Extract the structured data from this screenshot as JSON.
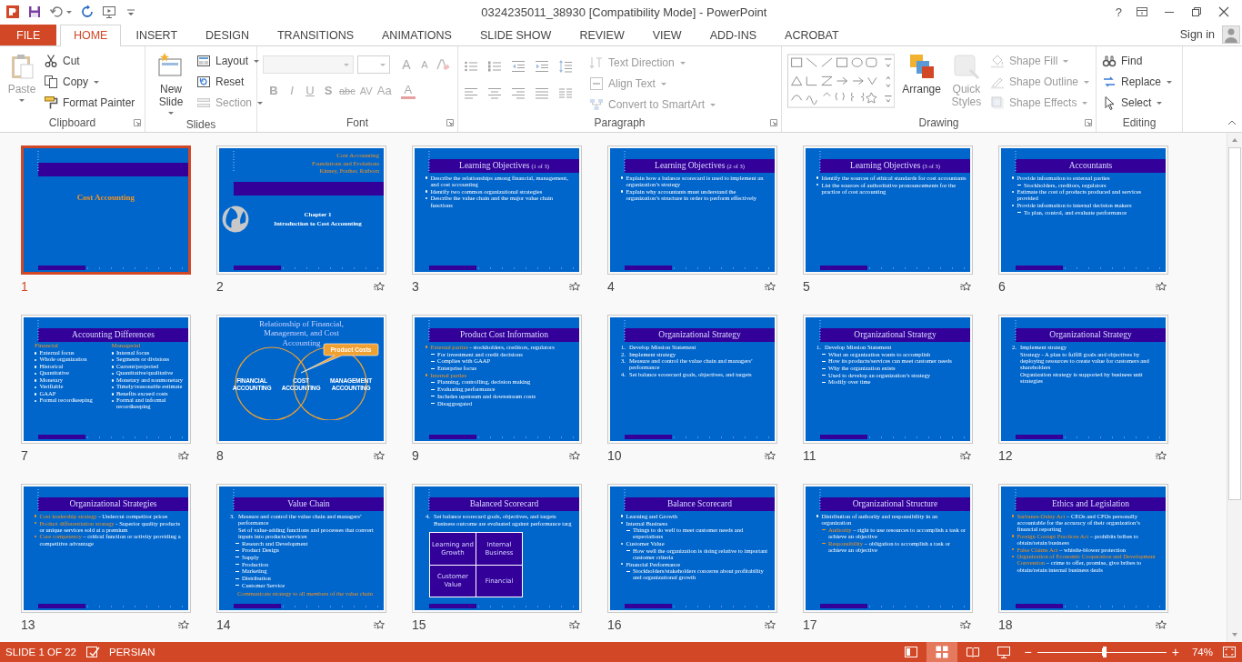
{
  "window": {
    "title": "0324235011_38930 [Compatibility Mode] - PowerPoint",
    "help": "?"
  },
  "tabs": [
    {
      "label": "FILE",
      "kind": "file",
      "selected": false
    },
    {
      "label": "HOME",
      "kind": "tab",
      "selected": true
    },
    {
      "label": "INSERT",
      "kind": "tab",
      "selected": false
    },
    {
      "label": "DESIGN",
      "kind": "tab",
      "selected": false
    },
    {
      "label": "TRANSITIONS",
      "kind": "tab",
      "selected": false
    },
    {
      "label": "ANIMATIONS",
      "kind": "tab",
      "selected": false
    },
    {
      "label": "SLIDE SHOW",
      "kind": "tab",
      "selected": false
    },
    {
      "label": "REVIEW",
      "kind": "tab",
      "selected": false
    },
    {
      "label": "VIEW",
      "kind": "tab",
      "selected": false
    },
    {
      "label": "ADD-INS",
      "kind": "tab",
      "selected": false
    },
    {
      "label": "ACROBAT",
      "kind": "tab",
      "selected": false
    }
  ],
  "sign_in": "Sign in",
  "ribbon": {
    "clipboard": {
      "label": "Clipboard",
      "paste": {
        "label": "Paste",
        "disabled": true,
        "dropdown": true
      },
      "items": [
        {
          "label": "Cut",
          "disabled": false,
          "dropdown": false
        },
        {
          "label": "Copy",
          "disabled": false,
          "dropdown": true
        },
        {
          "label": "Format Painter",
          "disabled": false,
          "dropdown": false
        }
      ]
    },
    "slides": {
      "label": "Slides",
      "new_slide": {
        "label": "New Slide",
        "disabled": false,
        "dropdown": true
      },
      "items": [
        {
          "label": "Layout",
          "disabled": false,
          "dropdown": true
        },
        {
          "label": "Reset",
          "disabled": false,
          "dropdown": false
        },
        {
          "label": "Section",
          "disabled": true,
          "dropdown": true
        }
      ]
    },
    "font": {
      "label": "Font",
      "disabled": true,
      "size_buttons": [
        "A",
        "A"
      ],
      "style_buttons": [
        "B",
        "I",
        "U",
        "S",
        "abc",
        "AV",
        "Aa",
        "A"
      ]
    },
    "paragraph": {
      "label": "Paragraph",
      "items": [
        {
          "label": "Text Direction",
          "disabled": true,
          "dropdown": true
        },
        {
          "label": "Align Text",
          "disabled": true,
          "dropdown": true
        },
        {
          "label": "Convert to SmartArt",
          "disabled": true,
          "dropdown": true
        }
      ]
    },
    "drawing": {
      "label": "Drawing",
      "arrange": {
        "label": "Arrange",
        "disabled": false
      },
      "quick_styles": {
        "label": "Quick Styles",
        "disabled": true
      },
      "items": [
        {
          "label": "Shape Fill",
          "disabled": true,
          "dropdown": true
        },
        {
          "label": "Shape Outline",
          "disabled": true,
          "dropdown": true
        },
        {
          "label": "Shape Effects",
          "disabled": true,
          "dropdown": true
        }
      ]
    },
    "editing": {
      "label": "Editing",
      "items": [
        {
          "label": "Find",
          "disabled": false,
          "dropdown": false
        },
        {
          "label": "Replace",
          "disabled": false,
          "dropdown": true
        },
        {
          "label": "Select",
          "disabled": false,
          "dropdown": true
        }
      ]
    }
  },
  "slides": [
    {
      "number": "1",
      "kind": "title",
      "selected": true,
      "title": "Cost Accounting"
    },
    {
      "number": "2",
      "kind": "chapter",
      "selected": false,
      "heading": [
        "Cost Accounting",
        "Foundations and Evolutions",
        "Kinney, Prather, Raiborn"
      ],
      "subtitle": [
        "Chapter 1",
        "Introduction to Cost Accounting"
      ]
    },
    {
      "number": "3",
      "kind": "bullets",
      "selected": false,
      "title": "Learning Objectives",
      "title_note": "(1 of 3)",
      "lines": [
        {
          "kind": "bullet",
          "text": "Describe the relationships among financial, management, and cost accounting"
        },
        {
          "kind": "bullet",
          "text": "Identify two common organizational strategies"
        },
        {
          "kind": "bullet",
          "text": "Describe the value chain and the major value chain functions"
        }
      ]
    },
    {
      "number": "4",
      "kind": "bullets",
      "selected": false,
      "title": "Learning Objectives",
      "title_note": "(2 of 3)",
      "lines": [
        {
          "kind": "bullet",
          "text": "Explain how a balance scorecard is used to implement an organization’s strategy"
        },
        {
          "kind": "bullet",
          "text": "Explain why accountants must understand the organization’s structure in order to perform effectively"
        }
      ]
    },
    {
      "number": "5",
      "kind": "bullets",
      "selected": false,
      "title": "Learning Objectives",
      "title_note": "(3 of 3)",
      "lines": [
        {
          "kind": "bullet",
          "text": "Identify the sources of ethical standards for cost accountants"
        },
        {
          "kind": "bullet",
          "text": "List the sources of authoritative pronouncements for the practice of cost accounting"
        }
      ]
    },
    {
      "number": "6",
      "kind": "bullets",
      "selected": false,
      "title": "Accountants",
      "lines": [
        {
          "kind": "bullet",
          "text": "Provide information to external parties"
        },
        {
          "kind": "sub",
          "text": "Stockholders, creditors, regulators"
        },
        {
          "kind": "bullet",
          "text": "Estimate the cost of products produced and services provided"
        },
        {
          "kind": "bullet",
          "text": "Provide information to internal decision makers"
        },
        {
          "kind": "sub",
          "text": "To plan, control, and evaluate performance"
        }
      ]
    },
    {
      "number": "7",
      "kind": "twocol",
      "selected": false,
      "title": "Accounting Differences",
      "columns": [
        {
          "heading": "Financial",
          "items": [
            "External focus",
            "Whole organization",
            "Historical",
            "Quantitative",
            "Monetary",
            "Verifiable",
            "GAAP",
            "Formal recordkeeping"
          ]
        },
        {
          "heading": "Managerial",
          "items": [
            "Internal focus",
            "Segments or divisions",
            "Current/projected",
            "Quantitative/qualitative",
            "Monetary and nonmonetary",
            "Timely/reasonable estimate",
            "Benefits exceed costs",
            "Formal and informal recordkeeping"
          ]
        }
      ]
    },
    {
      "number": "8",
      "kind": "venn",
      "selected": false,
      "title": "Relationship of Financial, Management, and Cost Accounting",
      "circle_labels": [
        [
          "FINANCIAL",
          "ACCOUNTING"
        ],
        [
          "COST",
          "ACCOUNTING"
        ],
        [
          "MANAGEMENT",
          "ACCOUNTING"
        ]
      ],
      "callout": "Product Costs"
    },
    {
      "number": "9",
      "kind": "bullets",
      "selected": false,
      "title": "Product Cost Information",
      "lines": [
        {
          "kind": "bullet",
          "lead": "External parties",
          "text": " - stockholders, creditors, regulators"
        },
        {
          "kind": "sub",
          "text": "For investment and credit decisions"
        },
        {
          "kind": "sub",
          "text": "Complies with GAAP"
        },
        {
          "kind": "sub",
          "text": "Enterprise focus"
        },
        {
          "kind": "bullet",
          "lead": "Internal parties"
        },
        {
          "kind": "sub",
          "text": "Planning, controlling, decision making"
        },
        {
          "kind": "sub",
          "text": "Evaluating performance"
        },
        {
          "kind": "sub",
          "text": "Includes upstream and downstream costs"
        },
        {
          "kind": "sub",
          "text": "Disaggregated"
        }
      ]
    },
    {
      "number": "10",
      "kind": "bullets",
      "selected": false,
      "title": "Organizational Strategy",
      "lines": [
        {
          "kind": "num",
          "num": "1.",
          "text": "Develop Mission Statement"
        },
        {
          "kind": "num",
          "num": "2.",
          "text": "Implement strategy"
        },
        {
          "kind": "num",
          "num": "3.",
          "text": "Measure and control the value chain and managers’ performance"
        },
        {
          "kind": "num",
          "num": "4.",
          "text": "Set balance scorecard goals, objectives, and targets"
        }
      ]
    },
    {
      "number": "11",
      "kind": "bullets",
      "selected": false,
      "title": "Organizational Strategy",
      "lines": [
        {
          "kind": "num",
          "num": "1.",
          "text": "Develop Mission Statement"
        },
        {
          "kind": "sub",
          "text": "What an organization wants to accomplish"
        },
        {
          "kind": "sub",
          "text": "How its products/services can meet customer needs"
        },
        {
          "kind": "sub",
          "text": "Why the organization exists"
        },
        {
          "kind": "sub",
          "text": "Used to develop an organization’s strategy"
        },
        {
          "kind": "sub",
          "text": "Modify over time"
        }
      ]
    },
    {
      "number": "12",
      "kind": "bullets",
      "selected": false,
      "title": "Organizational Strategy",
      "lines": [
        {
          "kind": "num",
          "num": "2.",
          "text": "Implement strategy"
        },
        {
          "kind": "plain",
          "text": "Strategy - A plan to fulfill goals and objectives by deploying resources to create value for customers and shareholders"
        },
        {
          "kind": "plain",
          "text": "Organization strategy is supported by business unit strategies"
        }
      ]
    },
    {
      "number": "13",
      "kind": "bullets",
      "selected": false,
      "title": "Organizational Strategies",
      "lines": [
        {
          "kind": "bullet",
          "lead": "Cost leadership strategy",
          "text": " - Undercut competitor prices"
        },
        {
          "kind": "bullet",
          "lead": "Product differentiation strategy",
          "text": " - Superior quality products or unique services sold at a premium"
        },
        {
          "kind": "bullet",
          "lead": "Core competency",
          "text": " – critical function or activity providing a competitive advantage"
        }
      ]
    },
    {
      "number": "14",
      "kind": "bullets",
      "selected": false,
      "title": "Value Chain",
      "lines": [
        {
          "kind": "num",
          "num": "3.",
          "text": "Measure and control the value chain and managers’ performance"
        },
        {
          "kind": "plain",
          "text": "Set of value-adding functions and processes that convert inputs into products/services"
        },
        {
          "kind": "sub",
          "text": "Research and Development"
        },
        {
          "kind": "sub",
          "text": "Product Design"
        },
        {
          "kind": "sub",
          "text": "Supply"
        },
        {
          "kind": "sub",
          "text": "Production"
        },
        {
          "kind": "sub",
          "text": "Marketing"
        },
        {
          "kind": "sub",
          "text": "Distribution"
        },
        {
          "kind": "sub",
          "text": "Customer Service"
        },
        {
          "kind": "footer",
          "text": "Communicate strategy to all members of the value chain"
        }
      ]
    },
    {
      "number": "15",
      "kind": "grid",
      "selected": false,
      "title": "Balanced Scorecard",
      "lines": [
        {
          "kind": "num",
          "num": "4.",
          "text": "Set balance scorecard goals, objectives, and targets"
        },
        {
          "kind": "plain",
          "text": "Business outcome are evaluated against performance targ"
        }
      ],
      "cells": [
        "Learning and Growth",
        "Internal Business",
        "Customer Value",
        "Financial"
      ]
    },
    {
      "number": "16",
      "kind": "bullets",
      "selected": false,
      "title": "Balance Scorecard",
      "lines": [
        {
          "kind": "bullet",
          "text": "Learning and Growth"
        },
        {
          "kind": "bullet",
          "text": "Internal Business"
        },
        {
          "kind": "sub",
          "text": "Things to do well to meet customer needs and expectations"
        },
        {
          "kind": "bullet",
          "text": "Customer Value"
        },
        {
          "kind": "sub",
          "text": "How well the organization is doing relative to important customer criteria"
        },
        {
          "kind": "bullet",
          "text": "Financial Performance"
        },
        {
          "kind": "sub",
          "text": "Stockholders/stakeholders concerns about profitability and organizational growth"
        }
      ]
    },
    {
      "number": "17",
      "kind": "bullets",
      "selected": false,
      "title": "Organizational Structure",
      "lines": [
        {
          "kind": "bullet",
          "text": "Distribution of authority and responsibility in an organization"
        },
        {
          "kind": "sub",
          "lead": "Authority",
          "text": " – right to use resources to accomplish a task or achieve an objective"
        },
        {
          "kind": "sub",
          "lead": "Responsibility",
          "text": " – obligation to accomplish a task or achieve an objective"
        }
      ]
    },
    {
      "number": "18",
      "kind": "bullets",
      "selected": false,
      "title": "Ethics and Legislation",
      "lines": [
        {
          "kind": "bullet",
          "lead": "Sarbanes-Oxley Act",
          "text": " – CEOs and CFOs personally accountable for the accuracy of their organization’s financial reporting"
        },
        {
          "kind": "bullet",
          "lead": "Foreign Corrupt Practices Act",
          "text": " – prohibits bribes to obtain/retain business"
        },
        {
          "kind": "bullet",
          "lead": "False Claims Act",
          "text": " – whistle-blower protection"
        },
        {
          "kind": "bullet",
          "lead": "Organization of Economic Cooperation and Development Convention",
          "text": " – crime to offer, promise, give bribes to obtain/retain internal business deals"
        }
      ]
    }
  ],
  "status_bar": {
    "slide_info": "SLIDE 1 OF 22",
    "language": "PERSIAN",
    "views": [
      {
        "selected": false
      },
      {
        "selected": true
      },
      {
        "selected": false
      },
      {
        "selected": false
      }
    ],
    "zoom_out": "−",
    "zoom_in": "+",
    "zoom": {
      "reading": "74%",
      "level": 0.52
    }
  }
}
